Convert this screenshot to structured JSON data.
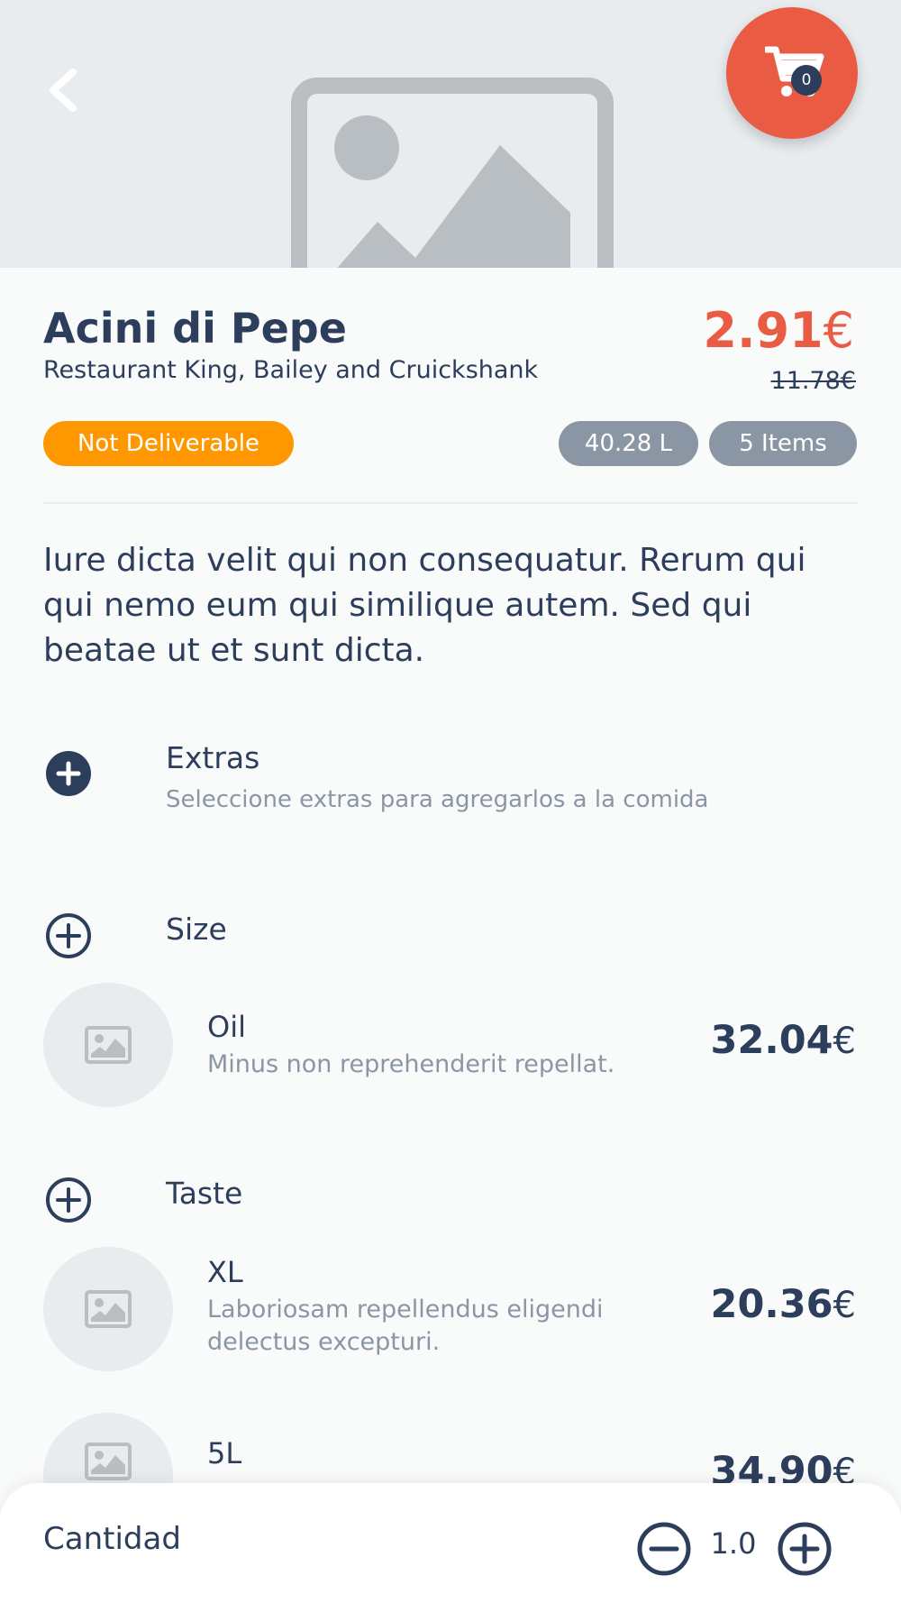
{
  "header": {
    "back_icon": "chevron-left-icon",
    "cart_icon": "cart-icon",
    "cart_count": "0",
    "placeholder_icon": "image-placeholder-icon"
  },
  "product": {
    "name": "Acini di Pepe",
    "restaurant": "Restaurant King, Bailey and Cruickshank",
    "price": "2.91",
    "price_currency": "€",
    "old_price": "11.78€",
    "badges": {
      "status": "Not Deliverable",
      "capacity": "40.28 L",
      "items": "5 Items"
    },
    "description": "Iure dicta velit qui non consequatur. Rerum qui qui nemo eum qui similique autem. Sed qui beatae ut et sunt dicta."
  },
  "sections": {
    "extras": {
      "title": "Extras",
      "subtitle": "Seleccione extras para agregarlos a la comida"
    },
    "size": {
      "title": "Size",
      "options": [
        {
          "name": "Oil",
          "description": "Minus non reprehenderit repellat.",
          "price": "32.04",
          "currency": "€"
        }
      ]
    },
    "taste": {
      "title": "Taste",
      "options": [
        {
          "name": "XL",
          "description": "Laboriosam repellendus eligendi delectus excepturi.",
          "price": "20.36",
          "currency": "€"
        },
        {
          "name": "5L",
          "description": "",
          "price": "34.90",
          "currency": "€"
        }
      ]
    }
  },
  "quantity": {
    "label": "Cantidad",
    "value": "1.0"
  },
  "colors": {
    "accent": "#ea5b43",
    "primary": "#2c3e5b",
    "warning": "#ff9800",
    "muted": "#8b96a5",
    "background": "#f9fafa"
  }
}
